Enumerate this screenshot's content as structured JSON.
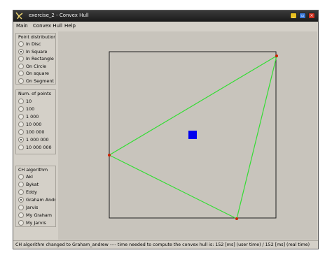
{
  "window": {
    "title": "exercise_2 - Convex Hull",
    "controls": {
      "minimize": "_",
      "maximize": "▫",
      "close": "×"
    }
  },
  "menu": [
    "Main",
    "Convex Hull",
    "Help"
  ],
  "point_distribution": {
    "title": "Point distribution",
    "options": [
      {
        "label": "In Disc",
        "checked": false
      },
      {
        "label": "In Square",
        "checked": true
      },
      {
        "label": "In Rectangle",
        "checked": false
      },
      {
        "label": "On Circle",
        "checked": false
      },
      {
        "label": "On square",
        "checked": false
      },
      {
        "label": "On Segment",
        "checked": false
      }
    ]
  },
  "num_points": {
    "title": "Num. of points",
    "options": [
      {
        "label": "10",
        "checked": false
      },
      {
        "label": "100",
        "checked": false
      },
      {
        "label": "1 000",
        "checked": false
      },
      {
        "label": "10 000",
        "checked": false
      },
      {
        "label": "100 000",
        "checked": false
      },
      {
        "label": "1 000 000",
        "checked": true
      },
      {
        "label": "10 000 000",
        "checked": false
      }
    ]
  },
  "ch_algorithm": {
    "title": "CH algorithm",
    "options": [
      {
        "label": "Akl",
        "checked": false
      },
      {
        "label": "Bykat",
        "checked": false
      },
      {
        "label": "Eddy",
        "checked": false
      },
      {
        "label": "Graham Andrew",
        "checked": true
      },
      {
        "label": "Jarvis",
        "checked": false
      },
      {
        "label": "My Graham",
        "checked": false
      },
      {
        "label": "My Jarvis",
        "checked": false
      }
    ]
  },
  "status": "CH algorithm changed to Graham_andrew ---- time needed to compute the convex hull is: 152 [ms] (user time) / 152 [ms] (real time)",
  "colors": {
    "hull": "#33dd33",
    "hull_vertex": "#cc2200",
    "center_marker": "#0000ee",
    "frame": "#202020"
  }
}
